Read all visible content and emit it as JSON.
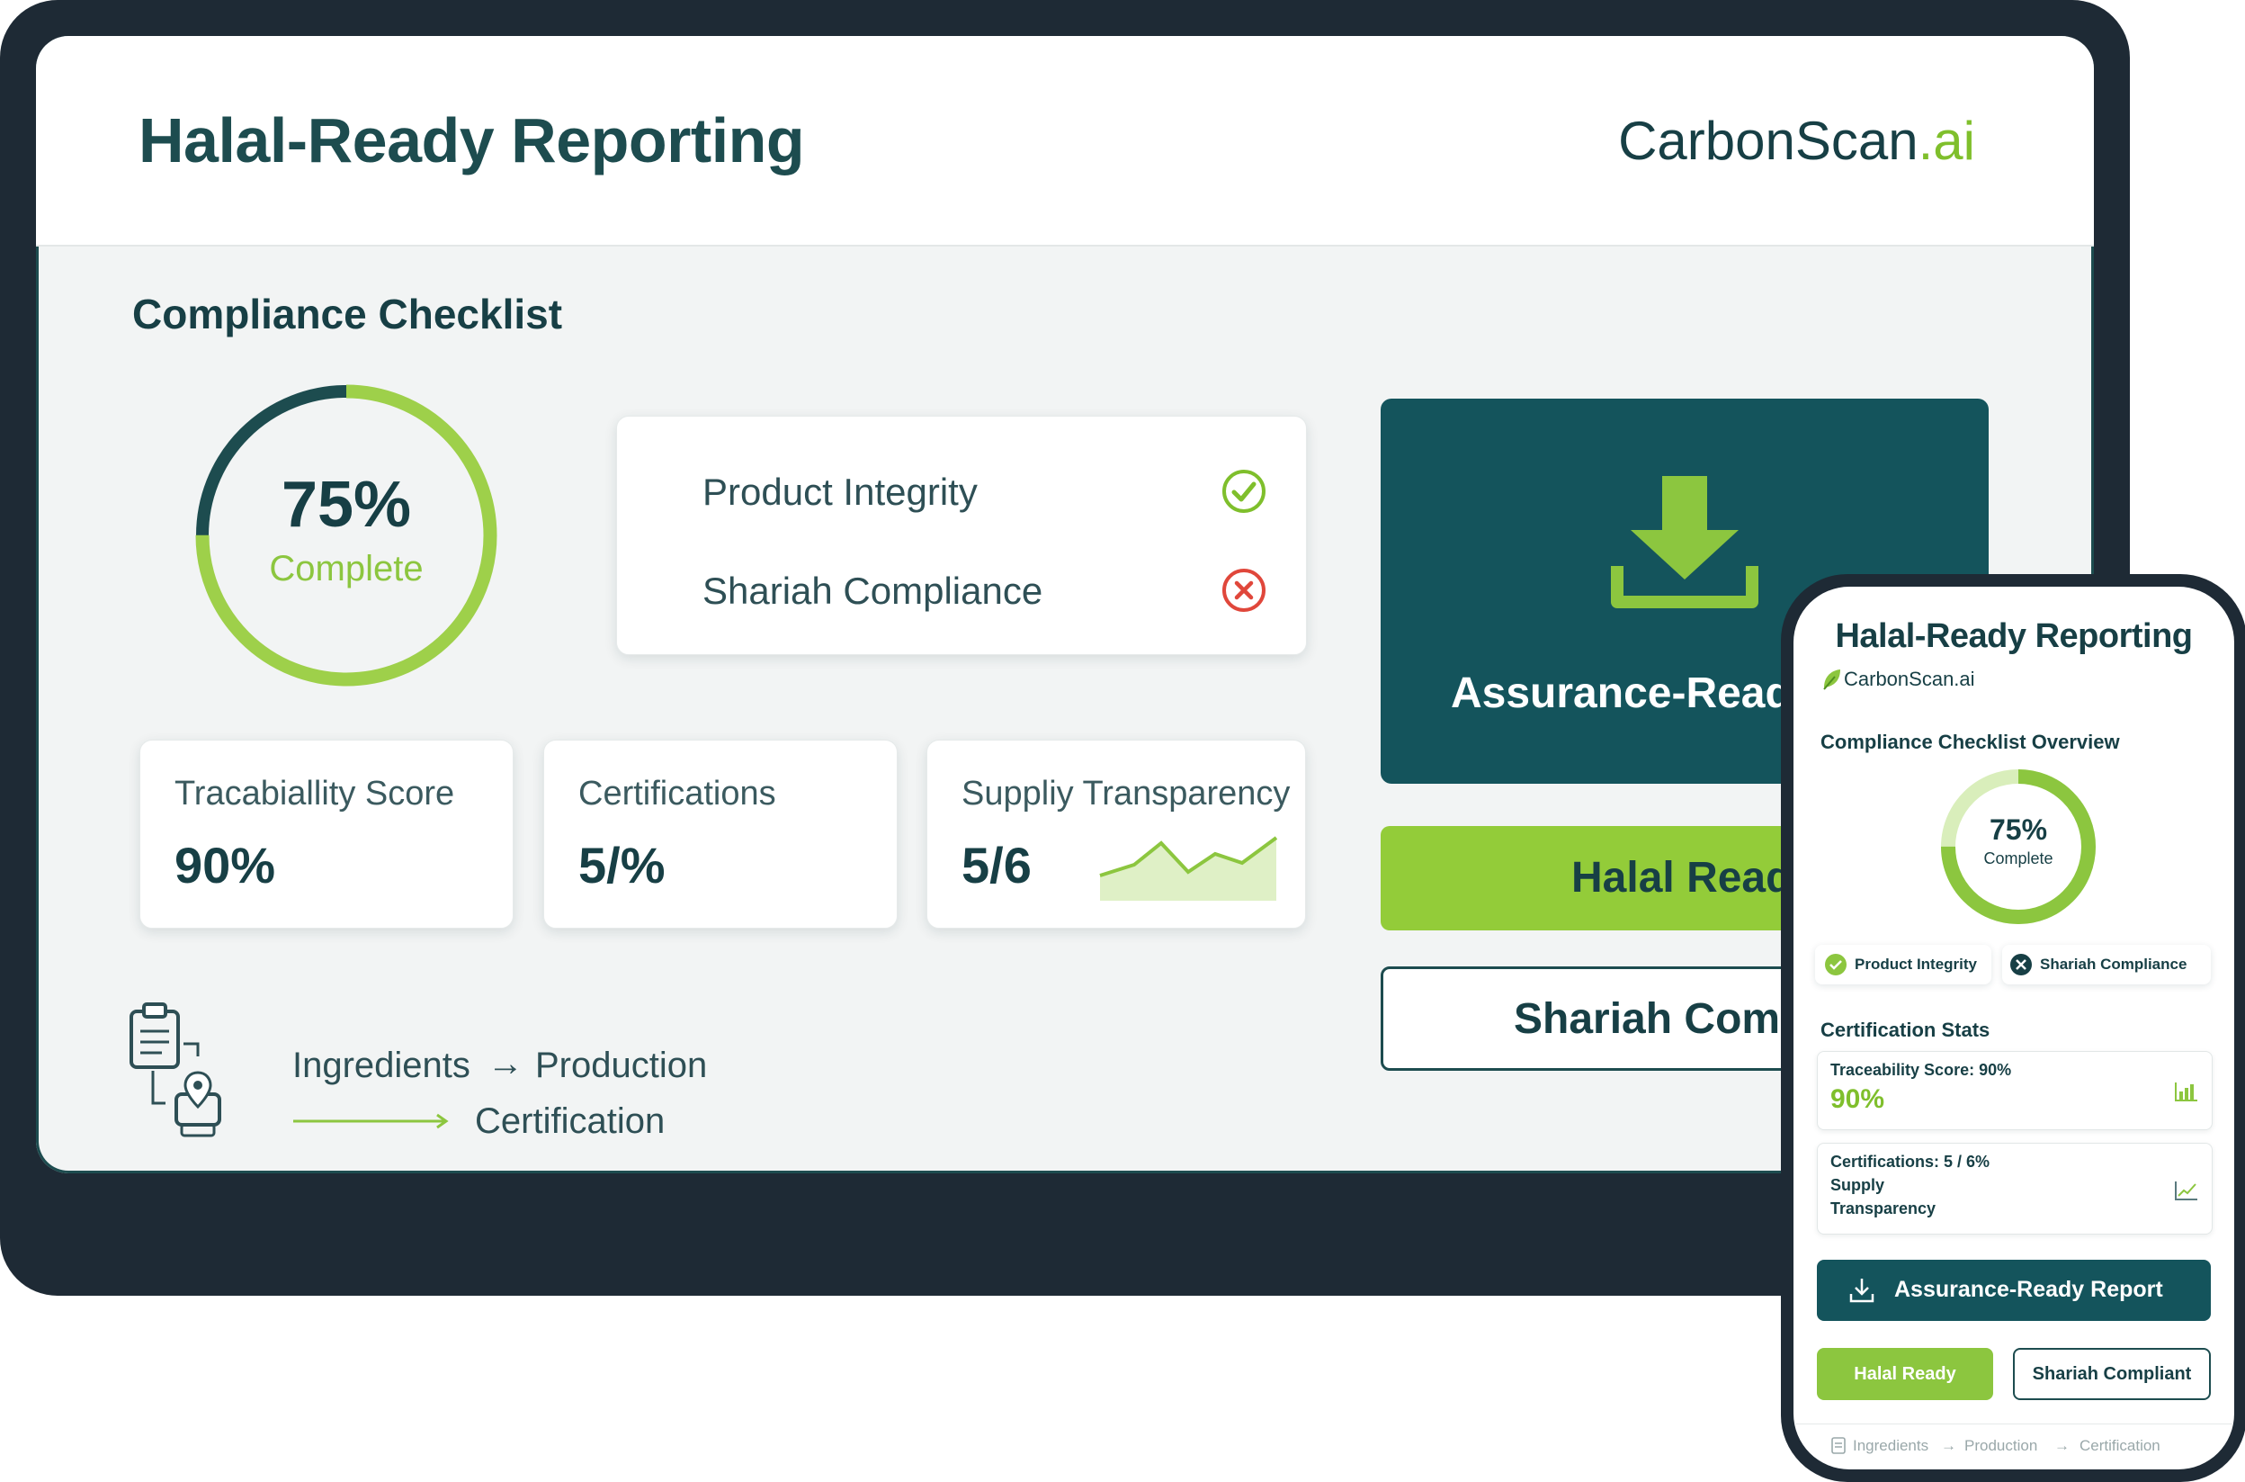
{
  "desktop": {
    "title": "Halal-Ready Reporting",
    "brand": {
      "name": "CarbonScan",
      "suffix": ".ai"
    },
    "section_title": "Compliance Checklist",
    "progress": {
      "value_text": "75%",
      "label": "Complete",
      "fraction": 0.75
    },
    "checklist": [
      {
        "label": "Product Integrity",
        "status": "pass",
        "icon": "check-circle-icon"
      },
      {
        "label": "Shariah Compliance",
        "status": "fail",
        "icon": "x-circle-icon"
      }
    ],
    "stats": [
      {
        "label": "Tracabiallity Score",
        "value": "90%"
      },
      {
        "label": "Certifications",
        "value": "5/%"
      },
      {
        "label": "Suppliy Transparency",
        "value": "5/6"
      }
    ],
    "flow": {
      "step1": "Ingredients",
      "step2": "Production",
      "step3": "Certification",
      "arrow": "→"
    },
    "assurance_label": "Assurance-Ready",
    "halal_button": "Halal Ready",
    "shariah_button": "Shariah Compl"
  },
  "mobile": {
    "title": "Halal-Ready Reporting",
    "brand": "CarbonScan.ai",
    "section_title": "Compliance Checklist Overview",
    "progress": {
      "value_text": "75%",
      "label": "Complete",
      "fraction": 0.75
    },
    "chips": [
      {
        "label": "Product Integrity",
        "status": "pass"
      },
      {
        "label": "Shariah Compliance",
        "status": "fail"
      }
    ],
    "stats_title": "Certification Stats",
    "stat1": {
      "label": "Traceability Score: 90%",
      "value": "90%"
    },
    "stat2": {
      "line1": "Certifications: 5 / 6%",
      "line2": "Supply",
      "line3": "Transparency"
    },
    "assurance_button": "Assurance-Ready Report",
    "halal_button": "Halal Ready",
    "shariah_button": "Shariah Compliant",
    "flow": {
      "step1": "Ingredients",
      "step2": "Production",
      "step3": "Certification",
      "arrow": "→"
    }
  },
  "colors": {
    "dark_teal": "#14545c",
    "lime": "#8cc63f",
    "navy_frame": "#1e2a35",
    "fail_red": "#e0473b"
  }
}
